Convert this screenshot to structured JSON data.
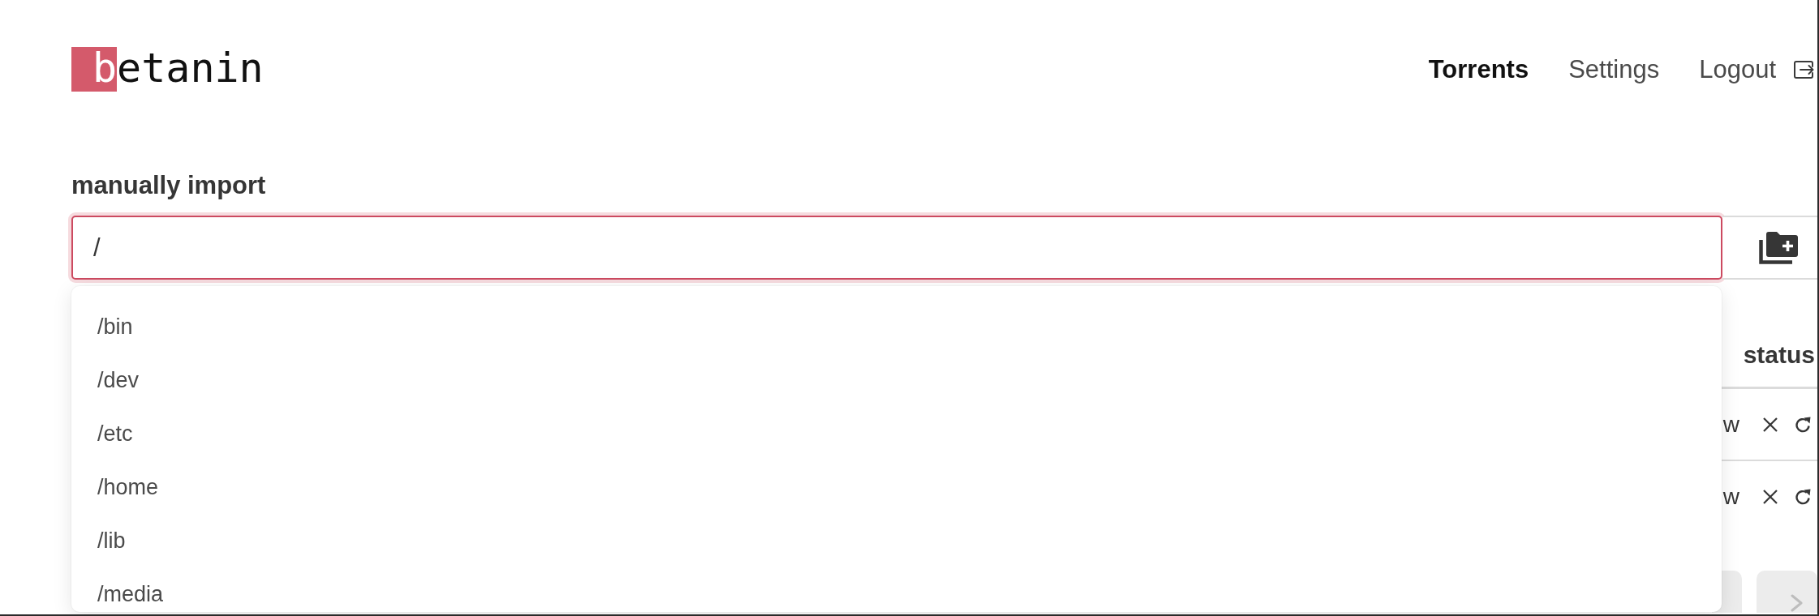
{
  "logo": {
    "mark": "b",
    "rest": "etanin"
  },
  "nav": {
    "links": [
      {
        "label": "Torrents",
        "selected": true
      },
      {
        "label": "Settings",
        "selected": false
      }
    ],
    "logout": "Logout"
  },
  "manual_import": {
    "label": "manually import",
    "value": "/",
    "suggestions": [
      "/bin",
      "/dev",
      "/etc",
      "/home",
      "/lib",
      "/media"
    ]
  },
  "table": {
    "columns": [
      "status"
    ],
    "rows": [
      {
        "status": "w"
      },
      {
        "status": "w"
      }
    ]
  },
  "pagination": {
    "pages": [
      {
        "selected": false
      }
    ]
  }
}
